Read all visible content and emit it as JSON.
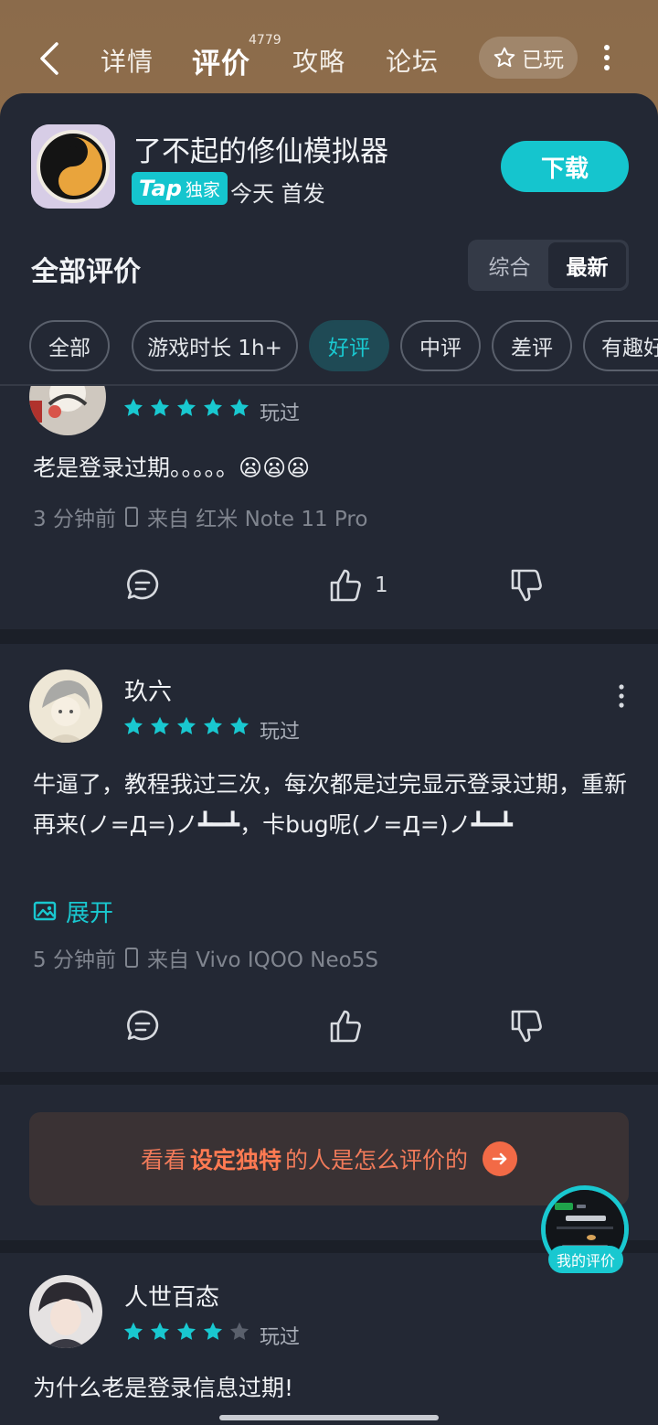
{
  "nav": {
    "tabs": [
      {
        "label": "详情"
      },
      {
        "label": "评价",
        "count": "4779"
      },
      {
        "label": "攻略"
      },
      {
        "label": "论坛"
      }
    ],
    "played_label": "已玩"
  },
  "game": {
    "title": "了不起的修仙模拟器",
    "badge_tap": "Tap",
    "badge_exclusive": "独家",
    "release": "今天 首发",
    "download_label": "下载"
  },
  "reviews_section": {
    "title": "全部评价",
    "sort_options": [
      "综合",
      "最新"
    ],
    "filters": [
      "全部",
      "游戏时长 1h+",
      "好评",
      "中评",
      "差评",
      "有趣好"
    ]
  },
  "reviews": [
    {
      "stars": 5,
      "played": "玩过",
      "text": "老是登录过期。。。。。😦😦😦",
      "time": "3 分钟前",
      "device": "来自 红米 Note 11 Pro",
      "likes": "1"
    },
    {
      "user": "玖六",
      "stars": 5,
      "played": "玩过",
      "text": "牛逼了，教程我过三次，每次都是过完显示登录过期，重新再来(ノ=Д=)ノ┻━┻，卡bug呢(ノ=Д=)ノ┻━┻",
      "expand": "展开",
      "time": "5 分钟前",
      "device": "来自 Vivo IQOO Neo5S"
    },
    {
      "user": "人世百态",
      "stars": 4,
      "played": "玩过",
      "text": "为什么老是登录信息过期!"
    }
  ],
  "promo": {
    "prefix": "看看",
    "highlight": "设定独特",
    "suffix": "的人是怎么评价的"
  },
  "floating": {
    "label": "我的评价"
  },
  "colors": {
    "accent": "#19C8D0",
    "sheet_bg": "#232834",
    "promo_text": "#F07A5A"
  }
}
